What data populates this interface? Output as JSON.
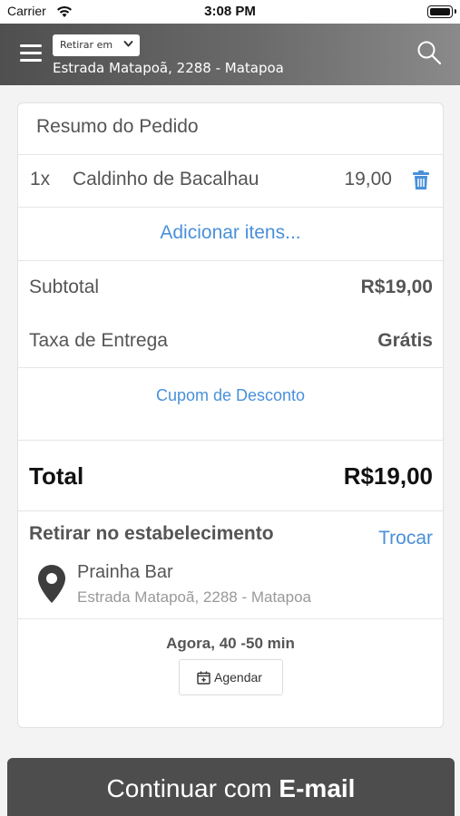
{
  "status_bar": {
    "carrier": "Carrier",
    "time": "3:08 PM"
  },
  "header": {
    "pickup_mode": "Retirar em",
    "address": "Estrada Matapoã, 2288 - Matapoa",
    "icons": [
      "menu-icon",
      "chevron-down-icon",
      "search-icon"
    ]
  },
  "order": {
    "title": "Resumo do Pedido",
    "items": [
      {
        "qty": "1x",
        "name": "Caldinho de Bacalhau",
        "price": "19,00"
      }
    ],
    "add_items_label": "Adicionar itens...",
    "subtotal_label": "Subtotal",
    "subtotal_value": "R$19,00",
    "delivery_label": "Taxa de Entrega",
    "delivery_value": "Grátis",
    "coupon_label": "Cupom de Desconto",
    "total_label": "Total",
    "total_value": "R$19,00"
  },
  "pickup": {
    "title": "Retirar no estabelecimento",
    "change_label": "Trocar",
    "store_name": "Prainha Bar",
    "store_address": "Estrada Matapoã, 2288 - Matapoa",
    "eta": "Agora, 40 -50 min",
    "schedule_label": "Agendar"
  },
  "footer": {
    "continue_prefix": "Continuar com ",
    "continue_bold": "E-mail"
  },
  "colors": {
    "accent": "#4a90d9",
    "header_dark": "#4f4f4f",
    "button_dark": "#4d4d4d"
  }
}
